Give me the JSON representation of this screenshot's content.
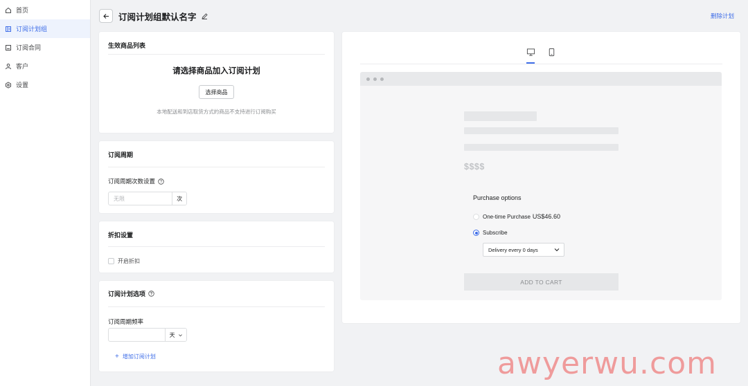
{
  "sidebar": {
    "items": [
      {
        "label": "首页",
        "icon": "home-icon"
      },
      {
        "label": "订阅计划组",
        "icon": "plan-group-icon",
        "active": true
      },
      {
        "label": "订阅合同",
        "icon": "contract-icon"
      },
      {
        "label": "客户",
        "icon": "user-icon"
      },
      {
        "label": "设置",
        "icon": "settings-icon"
      }
    ]
  },
  "header": {
    "title": "订阅计划组默认名字",
    "delete_label": "删除计划"
  },
  "products_card": {
    "title": "生效商品列表",
    "empty_title": "请选择商品加入订阅计划",
    "select_button": "选择商品",
    "note": "本地配送和到店取货方式的商品不支持进行订阅购买"
  },
  "cycle_card": {
    "title": "订阅周期",
    "field_label": "订阅周期次数设置",
    "placeholder": "无限",
    "suffix": "次"
  },
  "discount_card": {
    "title": "折扣设置",
    "checkbox_label": "开启折扣"
  },
  "options_card": {
    "title": "订阅计划选项",
    "field_label": "订阅周期频率",
    "unit": "天",
    "add_label": "增加订阅计划"
  },
  "preview": {
    "price_placeholder": "$$$$",
    "purchase_title": "Purchase options",
    "onetime_label": "One-time Purchase",
    "onetime_price": "US$46.60",
    "subscribe_label": "Subscribe",
    "delivery_value": "Delivery every 0 days",
    "cart_label": "ADD TO CART"
  },
  "watermark": "awyerwu.com",
  "colors": {
    "accent": "#3f6ee8",
    "background": "#f1f2f4",
    "watermark": "#ef8c8c"
  }
}
